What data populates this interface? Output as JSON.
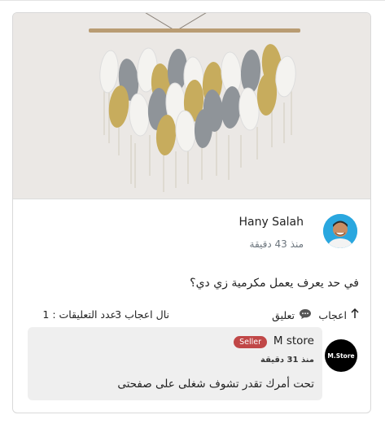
{
  "post": {
    "author_name": "Hany Salah",
    "time": "منذ 43 دقيقة",
    "text": "في حد يعرف يعمل مكرمية زي دي؟"
  },
  "actions": {
    "like_label": "اعجاب",
    "comment_label": "تعليق",
    "likes_stat": "نال اعجاب 3",
    "comments_stat": "عدد التعليقات : 1"
  },
  "comment": {
    "author": "M store",
    "badge": "Seller",
    "time": "منذ 31 دقيقة",
    "text": "تحت أمرك تقدر تشوف شغلى على صفحتى",
    "avatar_text": "M.Store"
  },
  "colors": {
    "badge": "#c04747",
    "bubble": "#efefef",
    "macrame_mustard": "#c7ac5d",
    "macrame_gray": "#8f9499",
    "macrame_white": "#f4f3f0"
  }
}
